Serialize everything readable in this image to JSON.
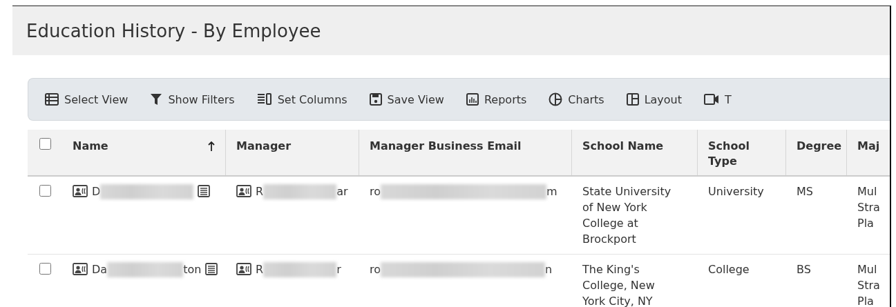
{
  "page": {
    "title": "Education History - By Employee"
  },
  "toolbar": [
    {
      "kind": "list",
      "label": "Select View"
    },
    {
      "kind": "filter",
      "label": "Show Filters"
    },
    {
      "kind": "columns",
      "label": "Set Columns"
    },
    {
      "kind": "save",
      "label": "Save View"
    },
    {
      "kind": "reports",
      "label": "Reports"
    },
    {
      "kind": "charts",
      "label": "Charts"
    },
    {
      "kind": "layout",
      "label": "Layout"
    },
    {
      "kind": "video",
      "label": "T"
    }
  ],
  "table": {
    "select_all": {
      "checked": false
    },
    "columns": [
      {
        "label": "Name",
        "sorted": true
      },
      {
        "label": "Manager",
        "sorted": false
      },
      {
        "label": "Manager Business Email",
        "sorted": false
      },
      {
        "label": "School Name",
        "sorted": false
      },
      {
        "label": "School Type",
        "sorted": false
      },
      {
        "label": "Degree",
        "sorted": false
      },
      {
        "label": "Maj",
        "sorted": false
      }
    ],
    "rows": [
      {
        "checked": false,
        "name": {
          "start": "D"
        },
        "manager": {
          "start": "R",
          "end": "ar"
        },
        "email": {
          "start": "ro",
          "end": "m"
        },
        "school_name": "State University of New York College at Brockport",
        "school_type": "University",
        "degree": "MS",
        "major": "Mul\nStra\nPla"
      },
      {
        "checked": false,
        "name": {
          "start": "Da",
          "end": "ton"
        },
        "manager": {
          "start": "R",
          "end": "r"
        },
        "email": {
          "start": "ro",
          "end": "n"
        },
        "school_name": "The King's College, New York City, NY",
        "school_type": "College",
        "degree": "BS",
        "major": "Mul\nStra\nPla"
      }
    ]
  }
}
